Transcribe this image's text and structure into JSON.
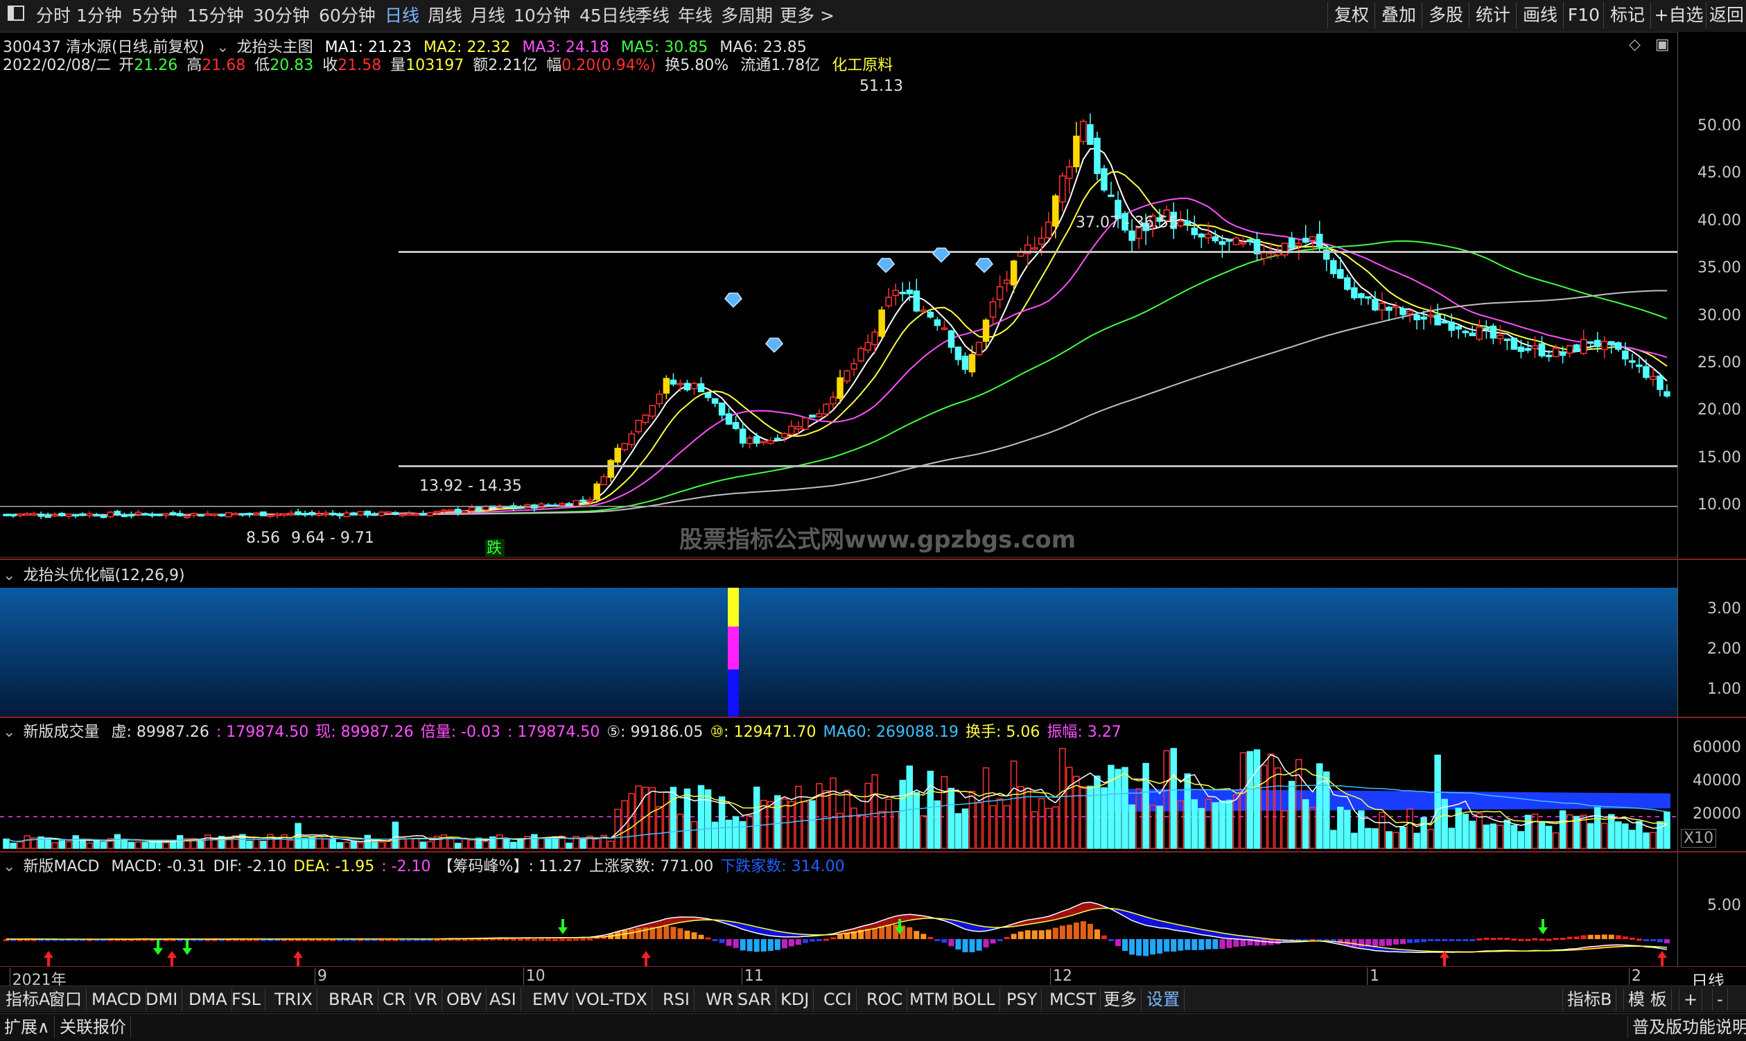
{
  "toolbar": {
    "menu_icon": "window-menu-icon",
    "periods": [
      "分时",
      "1分钟",
      "5分钟",
      "15分钟",
      "30分钟",
      "60分钟",
      "日线",
      "周线",
      "月线",
      "10分钟",
      "45日线",
      "季线",
      "年线",
      "多周期",
      "更多 >"
    ],
    "active_period": "日线",
    "right_buttons": [
      "复权",
      "叠加",
      "多股",
      "统计",
      "画线",
      "F10",
      "标记",
      "+自选",
      "返回"
    ]
  },
  "main_chart": {
    "header1": {
      "code_name": "300437 清水源(日线,前复权)",
      "indicator_name": "龙抬头主图",
      "ma1": "MA1: 21.23",
      "ma2": "MA2: 22.32",
      "ma3": "MA3: 24.18",
      "ma5": "MA5: 30.85",
      "ma6": "MA6: 23.85"
    },
    "header2": {
      "date": "2022/02/08/二",
      "open_label": "开",
      "open": "21.26",
      "high_label": "高",
      "high": "21.68",
      "low_label": "低",
      "low": "20.83",
      "close_label": "收",
      "close": "21.58",
      "vol_label": "量",
      "vol": "103197",
      "amt_label": "额",
      "amt": "2.21亿",
      "chg_label": "幅",
      "chg": "0.20(0.94%)",
      "turn": "换5.80%",
      "float_shares": "流通1.78亿",
      "sector": "化工原料"
    },
    "annotations": {
      "peak": "51.13",
      "upper_band": "37.07 - 36.55",
      "lower_band": "13.92 - 14.35",
      "bottom_left": "8.56",
      "bottom_range": "9.64 - 9.71",
      "signal": "跌",
      "watermark": "股票指标公式网www.gpzbgs.com"
    },
    "y_ticks": [
      "50.00",
      "45.00",
      "40.00",
      "35.00",
      "30.00",
      "25.00",
      "20.00",
      "15.00",
      "10.00"
    ]
  },
  "pane2": {
    "title": "龙抬头优化幅(12,26,9)",
    "y_ticks": [
      "3.00",
      "2.00",
      "1.00"
    ]
  },
  "pane3": {
    "title": "新版成交量",
    "items": [
      {
        "text": "虚: 89987.26",
        "color": "#e0e0e0"
      },
      {
        "text": ": 179874.50",
        "color": "#ff50ff"
      },
      {
        "text": "现: 89987.26",
        "color": "#ff50ff"
      },
      {
        "text": "倍量: -0.03",
        "color": "#ff50ff"
      },
      {
        "text": ": 179874.50",
        "color": "#ff50ff"
      },
      {
        "text": "⑤: 99186.05",
        "color": "#e0e0e0"
      },
      {
        "text": "⑩: 129471.70",
        "color": "#ffff40"
      },
      {
        "text": "MA60: 269088.19",
        "color": "#40c0ff"
      },
      {
        "text": "换手: 5.06",
        "color": "#ffff40"
      },
      {
        "text": "振幅: 3.27",
        "color": "#ff50ff"
      }
    ],
    "y_ticks": [
      "60000",
      "40000",
      "20000"
    ],
    "unit": "X10"
  },
  "pane4": {
    "title": "新版MACD",
    "items": [
      {
        "text": "MACD: -0.31",
        "color": "#e0e0e0"
      },
      {
        "text": "DIF: -2.10",
        "color": "#e0e0e0"
      },
      {
        "text": "DEA: -1.95",
        "color": "#ffff40"
      },
      {
        "text": ": -2.10",
        "color": "#ff50ff"
      },
      {
        "text": "【筹码峰%】: 11.27",
        "color": "#e0e0e0"
      },
      {
        "text": "上涨家数: 771.00",
        "color": "#e0e0e0"
      },
      {
        "text": "下跌家数: 314.00",
        "color": "#2060ff"
      }
    ],
    "y_ticks": [
      "5.00"
    ]
  },
  "x_axis": {
    "labels": [
      {
        "text": "2021年",
        "pos": 0.004
      },
      {
        "text": "9",
        "pos": 0.187
      },
      {
        "text": "10",
        "pos": 0.312
      },
      {
        "text": "11",
        "pos": 0.443
      },
      {
        "text": "12",
        "pos": 0.628
      },
      {
        "text": "1",
        "pos": 0.818
      },
      {
        "text": "2",
        "pos": 0.975
      }
    ],
    "right_label": "日线"
  },
  "bottom_tabs": {
    "items": [
      "指标A",
      "窗口",
      "MACD",
      "DMI",
      "DMA",
      "FSL",
      "TRIX",
      "BRAR",
      "CR",
      "VR",
      "OBV",
      "ASI",
      "EMV",
      "VOL-TDX",
      "RSI",
      "WR",
      "SAR",
      "KDJ",
      "CCI",
      "ROC",
      "MTM",
      "BOLL",
      "PSY",
      "MCST",
      "更多",
      "设置"
    ],
    "active": "设置",
    "right": [
      "指标B",
      "模 板",
      "+",
      "-"
    ]
  },
  "status_bar": {
    "left": [
      "扩展∧",
      "关联报价"
    ],
    "right": "普及版功能说明"
  },
  "colors": {
    "up_red": "#ff3030",
    "down_cyan": "#54ffff",
    "ma1": "#ffffff",
    "ma2": "#ffff40",
    "ma3": "#ff50ff",
    "ma5": "#40ff40",
    "ma6": "#c0c0c0"
  }
}
